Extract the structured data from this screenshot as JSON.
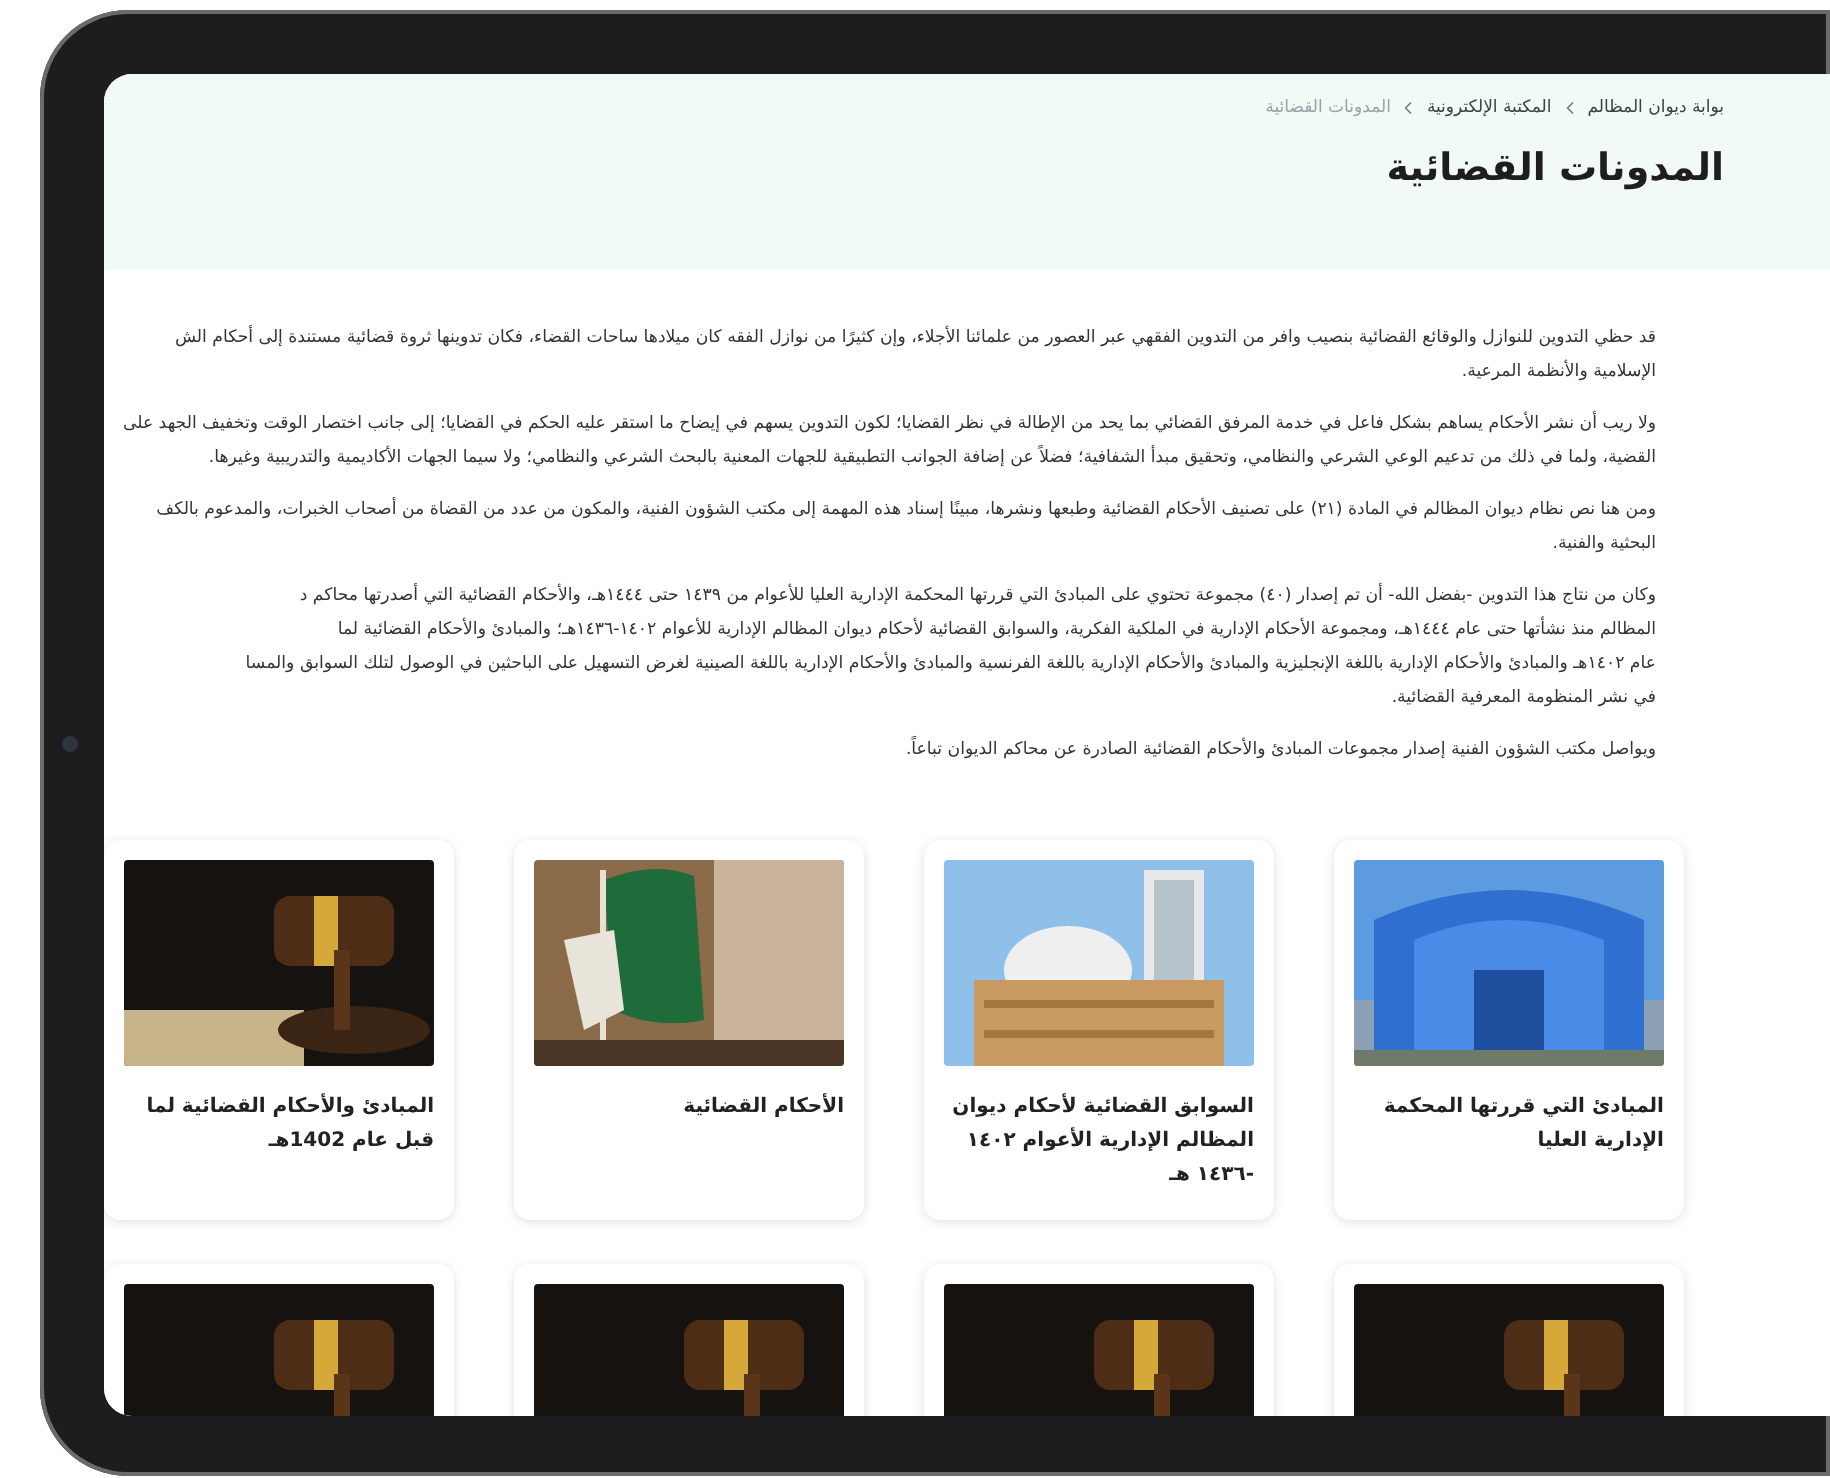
{
  "breadcrumb": [
    {
      "label": "بوابة ديوان المظالم",
      "current": false
    },
    {
      "label": "المكتبة الإلكترونية",
      "current": false
    },
    {
      "label": "المدونات القضائية",
      "current": true
    }
  ],
  "title": "المدونات القضائية",
  "paragraphs": [
    {
      "lines": [
        "قد حظي التدوين للنوازل والوقائع القضائية بنصيب وافر من التدوين الفقهي عبر العصور من علمائنا الأجلاء، وإن كثيرًا من نوازل الفقه كان ميلادها ساحات القضاء، فكان تدوينها ثروة قضائية مستندة إلى أحكام الش",
        "الإسلامية والأنظمة المرعية."
      ]
    },
    {
      "lines": [
        "ولا ريب أن نشر الأحكام يساهم بشكل فاعل في خدمة المرفق القضائي بما يحد من الإطالة في نظر القضايا؛ لكون التدوين يسهم في إيضاح ما استقر عليه الحكم في القضايا؛ إلى جانب اختصار الوقت وتخفيف الجهد على",
        "القضية، ولما في ذلك من تدعيم الوعي الشرعي والنظامي، وتحقيق مبدأ الشفافية؛ فضلاً عن إضافة الجوانب التطبيقية للجهات المعنية بالبحث الشرعي والنظامي؛ ولا سيما الجهات الأكاديمية والتدريبية وغيرها."
      ]
    },
    {
      "lines": [
        "ومن هنا نص نظام ديوان المظالم في المادة (٢١) على تصنيف الأحكام القضائية وطبعها ونشرها، مبينًا إسناد هذه المهمة إلى مكتب الشؤون الفنية، والمكون من عدد من القضاة من أصحاب الخبرات، والمدعوم بالكف",
        "البحثية والفنية."
      ]
    },
    {
      "lines": [
        "وكان من نتاج هذا التدوين -بفضل الله- أن تم إصدار (٤٠) مجموعة تحتوي على المبادئ التي قررتها المحكمة الإدارية العليا للأعوام من ١٤٣٩ حتى ١٤٤٤هـ، والأحكام القضائية التي أصدرتها محاكم د",
        "المظالم منذ نشأتها حتى عام ١٤٤٤هـ، ومجموعة الأحكام الإدارية في الملكية الفكرية، والسوابق القضائية لأحكام ديوان المظالم الإدارية للأعوام ١٤٠٢-١٤٣٦هـ؛ والمبادئ والأحكام القضائية لما",
        "عام ١٤٠٢هـ والمبادئ والأحكام الإدارية باللغة الإنجليزية والمبادئ والأحكام الإدارية باللغة الفرنسية والمبادئ والأحكام الإدارية باللغة الصينية لغرض التسهيل على الباحثين في الوصول لتلك السوابق والمسا",
        "في نشر المنظومة المعرفية القضائية."
      ]
    },
    {
      "lines": [
        "ويواصل مكتب الشؤون الفنية إصدار مجموعات المبادئ والأحكام القضائية الصادرة عن محاكم الديوان تباعاً."
      ]
    }
  ],
  "cards": [
    {
      "kind": "titled",
      "title": "المبادئ التي قررتها المحكمة الإدارية العليا"
    },
    {
      "kind": "titled",
      "title": "السوابق القضائية لأحكام ديوان المظالم الإدارية الأعوام ١٤٠٢ -١٤٣٦ هـ"
    },
    {
      "kind": "titled",
      "title": "الأحكام القضائية"
    },
    {
      "kind": "titled",
      "title": "المبادئ والأحكام القضائية لما قبل عام 1402هـ"
    },
    {
      "kind": "picture"
    },
    {
      "kind": "picture"
    },
    {
      "kind": "picture"
    },
    {
      "kind": "picture"
    }
  ]
}
